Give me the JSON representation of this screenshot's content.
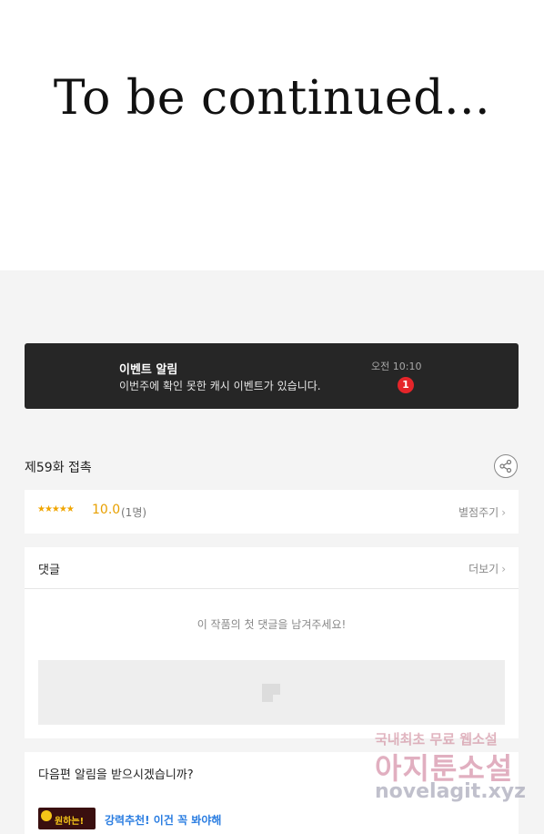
{
  "content": {
    "end_text": "To be continued..."
  },
  "banner": {
    "title": "이벤트 알림",
    "description": "이번주에 확인 못한 캐시 이벤트가 있습니다.",
    "time": "오전 10:10",
    "badge_count": "1"
  },
  "episode": {
    "title": "제59화 접촉",
    "share_icon": "share-icon"
  },
  "rating": {
    "stars": "★★★★★",
    "score": "10.0",
    "count": "(1명)",
    "rate_button": "별점주기"
  },
  "comments": {
    "header": "댓글",
    "more": "더보기",
    "empty": "이 작품의 첫 댓글을 남겨주세요!"
  },
  "next_notice": {
    "question": "다음편 알림을 받으시겠습니까?",
    "image_text": "원하는!",
    "link": "강력추천! 이건 꼭 봐야해"
  },
  "watermark": {
    "line1": "국내최초 무료 웹소설",
    "line2": "아지툰소설",
    "line3": "novelagit.xyz"
  },
  "colors": {
    "banner_bg": "#262626",
    "badge": "#e5252a",
    "star": "#f0a500",
    "link": "#2a7de1"
  }
}
